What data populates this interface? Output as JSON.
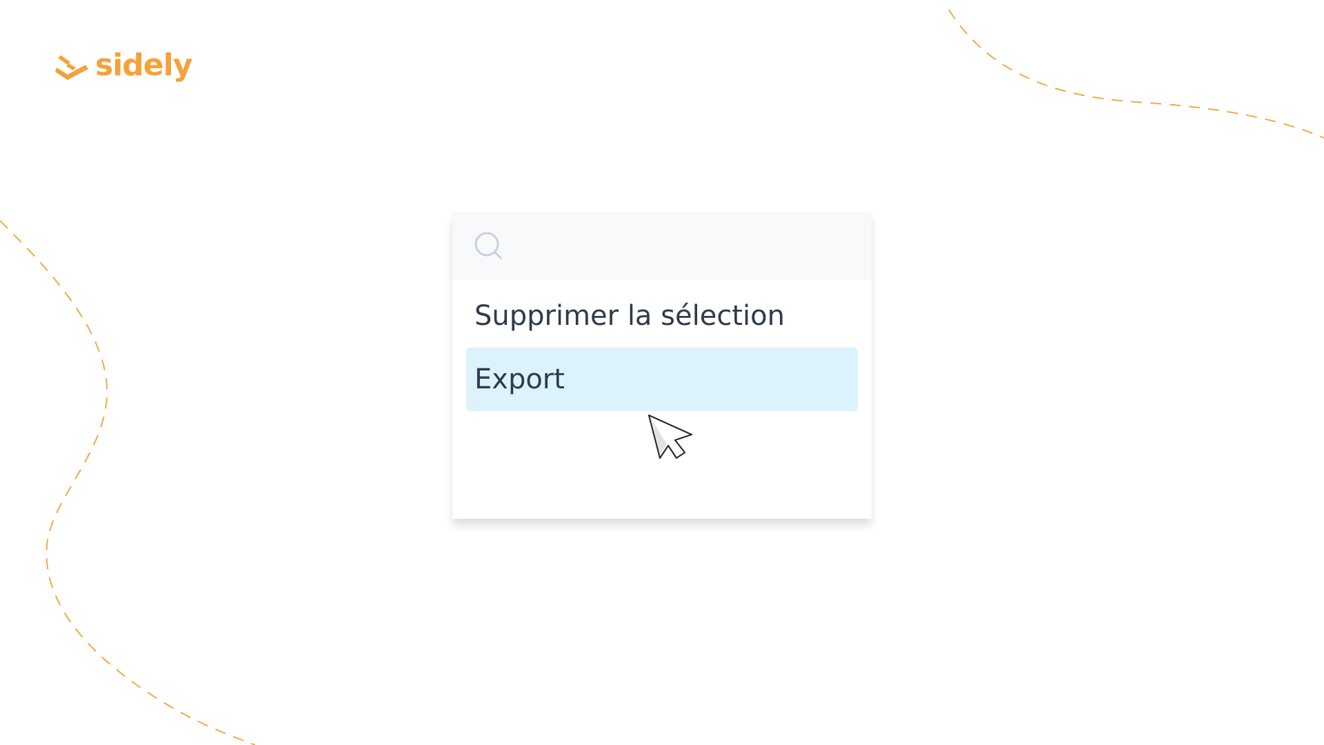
{
  "brand": {
    "name": "sidely",
    "color": "#f5a13a",
    "icon": "sidely-logo-icon"
  },
  "search": {
    "icon": "search-icon",
    "icon_color": "#c9cfdc",
    "value": "",
    "placeholder": ""
  },
  "menu": {
    "items": [
      {
        "label": "Supprimer la sélection",
        "active": false
      },
      {
        "label": "Export",
        "active": true
      }
    ],
    "highlight_color": "#dcf2fd"
  },
  "cursor": {
    "icon": "pointer-cursor-icon"
  },
  "decoration": {
    "dash_color": "#f2a947"
  }
}
